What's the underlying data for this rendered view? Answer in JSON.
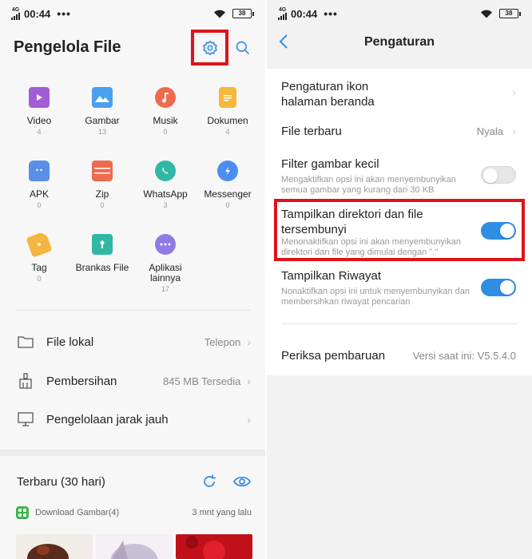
{
  "colors": {
    "accent": "#3a8ee6",
    "highlight": "#e0121b",
    "toggle_on": "#2f8de4"
  },
  "status": {
    "time": "00:44",
    "network": "4G",
    "dots": "•••",
    "battery": "38"
  },
  "left": {
    "title": "Pengelola File",
    "settings_icon": "gear-icon",
    "search_icon": "search-icon",
    "categories": [
      {
        "label": "Video",
        "count": "4",
        "icon": "video-icon"
      },
      {
        "label": "Gambar",
        "count": "13",
        "icon": "image-icon"
      },
      {
        "label": "Musik",
        "count": "0",
        "icon": "music-icon"
      },
      {
        "label": "Dokumen",
        "count": "4",
        "icon": "document-icon"
      },
      {
        "label": "APK",
        "count": "0",
        "icon": "android-icon"
      },
      {
        "label": "Zip",
        "count": "0",
        "icon": "zip-icon"
      },
      {
        "label": "WhatsApp",
        "count": "3",
        "icon": "whatsapp-icon"
      },
      {
        "label": "Messenger",
        "count": "0",
        "icon": "messenger-icon"
      },
      {
        "label": "Tag",
        "count": "0",
        "icon": "tag-icon"
      },
      {
        "label": "Brankas File",
        "count": "",
        "icon": "safe-icon"
      },
      {
        "label": "Aplikasi lainnya",
        "count": "17",
        "icon": "more-apps-icon"
      }
    ],
    "nav": [
      {
        "label": "File lokal",
        "value": "Telepon",
        "icon": "folder-icon"
      },
      {
        "label": "Pembersihan",
        "value": "845 MB Tersedia",
        "icon": "broom-icon"
      },
      {
        "label": "Pengelolaan jarak jauh",
        "value": "",
        "icon": "monitor-icon"
      }
    ],
    "recent": {
      "title": "Terbaru (30 hari)",
      "item_label": "Download Gambar(4)",
      "item_time": "3 mnt yang lalu"
    }
  },
  "right": {
    "title": "Pengaturan",
    "settings": [
      {
        "label": "Pengaturan ikon halaman beranda",
        "type": "link"
      },
      {
        "label": "File terbaru",
        "value": "Nyala",
        "type": "link"
      },
      {
        "label": "Filter gambar kecil",
        "desc": "Mengaktifkan opsi ini akan menyembunyikan semua gambar yang kurang dari 30 KB",
        "type": "toggle",
        "on": false
      },
      {
        "label": "Tampilkan direktori dan file tersembunyi",
        "desc": "Menonaktifkan opsi ini akan menyembunyikan direktori dan file yang dimulai dengan \".\"",
        "type": "toggle",
        "on": true
      },
      {
        "label": "Tampilkan Riwayat",
        "desc": "Nonaktifkan opsi ini untuk menyembunyikan dan membersihkan riwayat pencarian",
        "type": "toggle",
        "on": true
      }
    ],
    "update": {
      "label": "Periksa pembaruan",
      "value": "Versi saat ini: V5.5.4.0"
    }
  }
}
